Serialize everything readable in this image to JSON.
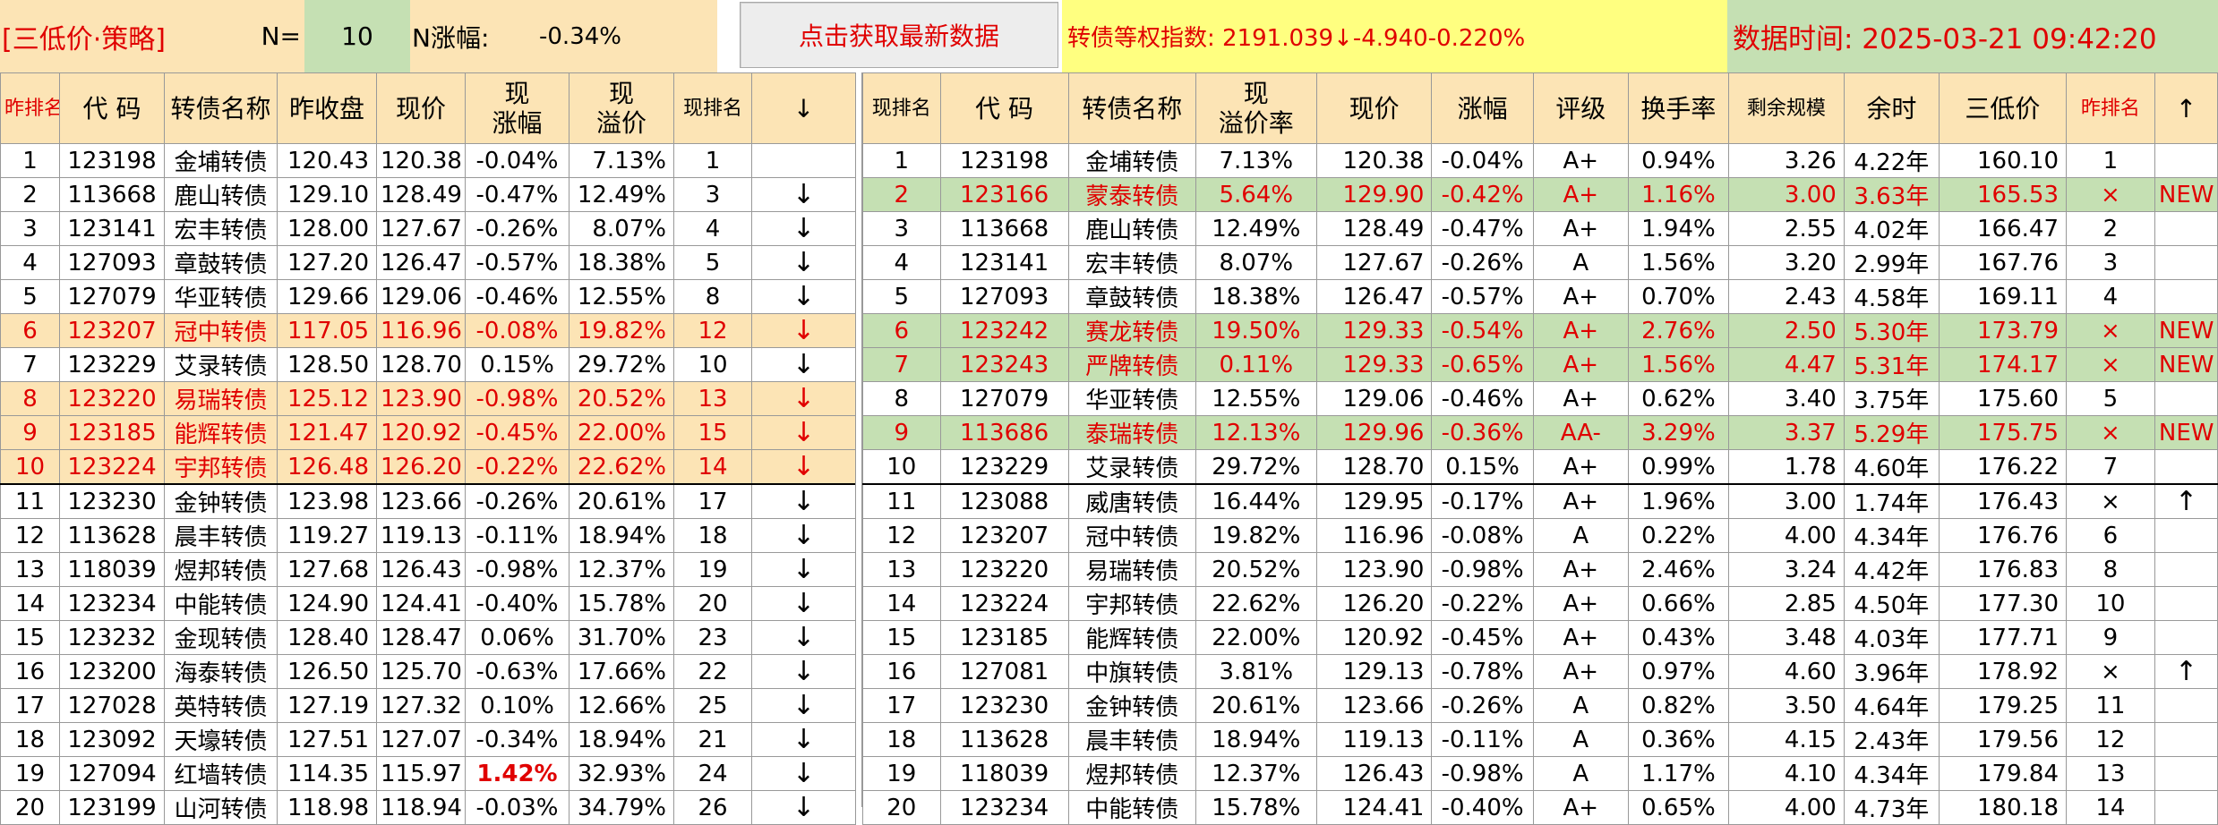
{
  "header": {
    "strategy": "[三低价·策略]",
    "n_label": "N=",
    "n_value": "10",
    "chg_label": "N涨幅:",
    "chg_value": "-0.34%",
    "refresh_button": "点击获取最新数据",
    "index_text": "转债等权指数:  2191.039↓-4.940-0.220%",
    "time_text": "数据时间: 2025-03-21 09:42:20"
  },
  "left": {
    "columns": [
      "昨排名",
      "代 码",
      "转债名称",
      "昨收盘",
      "现价",
      "现\n涨幅",
      "现\n溢价",
      "现排名",
      "↓"
    ],
    "rows": [
      {
        "rank": "1",
        "code": "123198",
        "name": "金埔转债",
        "prev": "120.43",
        "price": "120.38",
        "chg": "-0.04%",
        "prem": "7.13%",
        "now": "1",
        "arrow": ""
      },
      {
        "rank": "2",
        "code": "113668",
        "name": "鹿山转债",
        "prev": "129.10",
        "price": "128.49",
        "chg": "-0.47%",
        "prem": "12.49%",
        "now": "3",
        "arrow": "↓"
      },
      {
        "rank": "3",
        "code": "123141",
        "name": "宏丰转债",
        "prev": "128.00",
        "price": "127.67",
        "chg": "-0.26%",
        "prem": "8.07%",
        "now": "4",
        "arrow": "↓"
      },
      {
        "rank": "4",
        "code": "127093",
        "name": "章鼓转债",
        "prev": "127.20",
        "price": "126.47",
        "chg": "-0.57%",
        "prem": "18.38%",
        "now": "5",
        "arrow": "↓"
      },
      {
        "rank": "5",
        "code": "127079",
        "name": "华亚转债",
        "prev": "129.66",
        "price": "129.06",
        "chg": "-0.46%",
        "prem": "12.55%",
        "now": "8",
        "arrow": "↓"
      },
      {
        "rank": "6",
        "code": "123207",
        "name": "冠中转债",
        "prev": "117.05",
        "price": "116.96",
        "chg": "-0.08%",
        "prem": "19.82%",
        "now": "12",
        "arrow": "↓"
      },
      {
        "rank": "7",
        "code": "123229",
        "name": "艾录转债",
        "prev": "128.50",
        "price": "128.70",
        "chg": "0.15%",
        "prem": "29.72%",
        "now": "10",
        "arrow": "↓"
      },
      {
        "rank": "8",
        "code": "123220",
        "name": "易瑞转债",
        "prev": "125.12",
        "price": "123.90",
        "chg": "-0.98%",
        "prem": "20.52%",
        "now": "13",
        "arrow": "↓"
      },
      {
        "rank": "9",
        "code": "123185",
        "name": "能辉转债",
        "prev": "121.47",
        "price": "120.92",
        "chg": "-0.45%",
        "prem": "22.00%",
        "now": "15",
        "arrow": "↓"
      },
      {
        "rank": "10",
        "code": "123224",
        "name": "宇邦转债",
        "prev": "126.48",
        "price": "126.20",
        "chg": "-0.22%",
        "prem": "22.62%",
        "now": "14",
        "arrow": "↓"
      },
      {
        "rank": "11",
        "code": "123230",
        "name": "金钟转债",
        "prev": "123.98",
        "price": "123.66",
        "chg": "-0.26%",
        "prem": "20.61%",
        "now": "17",
        "arrow": "↓"
      },
      {
        "rank": "12",
        "code": "113628",
        "name": "晨丰转债",
        "prev": "119.27",
        "price": "119.13",
        "chg": "-0.11%",
        "prem": "18.94%",
        "now": "18",
        "arrow": "↓"
      },
      {
        "rank": "13",
        "code": "118039",
        "name": "煜邦转债",
        "prev": "127.68",
        "price": "126.43",
        "chg": "-0.98%",
        "prem": "12.37%",
        "now": "19",
        "arrow": "↓"
      },
      {
        "rank": "14",
        "code": "123234",
        "name": "中能转债",
        "prev": "124.90",
        "price": "124.41",
        "chg": "-0.40%",
        "prem": "15.78%",
        "now": "20",
        "arrow": "↓"
      },
      {
        "rank": "15",
        "code": "123232",
        "name": "金现转债",
        "prev": "128.40",
        "price": "128.47",
        "chg": "0.06%",
        "prem": "31.70%",
        "now": "23",
        "arrow": "↓"
      },
      {
        "rank": "16",
        "code": "123200",
        "name": "海泰转债",
        "prev": "126.50",
        "price": "125.70",
        "chg": "-0.63%",
        "prem": "17.66%",
        "now": "22",
        "arrow": "↓"
      },
      {
        "rank": "17",
        "code": "127028",
        "name": "英特转债",
        "prev": "127.19",
        "price": "127.32",
        "chg": "0.10%",
        "prem": "12.66%",
        "now": "25",
        "arrow": "↓"
      },
      {
        "rank": "18",
        "code": "123092",
        "name": "天壕转债",
        "prev": "127.51",
        "price": "127.07",
        "chg": "-0.34%",
        "prem": "18.94%",
        "now": "21",
        "arrow": "↓"
      },
      {
        "rank": "19",
        "code": "127094",
        "name": "红墙转债",
        "prev": "114.35",
        "price": "115.97",
        "chg": "1.42%",
        "prem": "32.93%",
        "now": "24",
        "arrow": "↓"
      },
      {
        "rank": "20",
        "code": "123199",
        "name": "山河转债",
        "prev": "118.98",
        "price": "118.94",
        "chg": "-0.03%",
        "prem": "34.79%",
        "now": "26",
        "arrow": "↓"
      }
    ]
  },
  "right": {
    "columns": [
      "现排名",
      "代 码",
      "转债名称",
      "现\n溢价率",
      "现价",
      "涨幅",
      "评级",
      "换手率",
      "剩余规模",
      "余时",
      "三低价",
      "昨排名",
      "↑"
    ],
    "rows": [
      {
        "now": "1",
        "code": "123198",
        "name": "金埔转债",
        "prem": "7.13%",
        "price": "120.38",
        "chg": "-0.04%",
        "rating": "A+",
        "turn": "0.94%",
        "size": "3.26",
        "rest": "4.22年",
        "tri": "160.10",
        "yday": "1",
        "flag": ""
      },
      {
        "now": "2",
        "code": "123166",
        "name": "蒙泰转债",
        "prem": "5.64%",
        "price": "129.90",
        "chg": "-0.42%",
        "rating": "A+",
        "turn": "1.16%",
        "size": "3.00",
        "rest": "3.63年",
        "tri": "165.53",
        "yday": "×",
        "flag": "NEW"
      },
      {
        "now": "3",
        "code": "113668",
        "name": "鹿山转债",
        "prem": "12.49%",
        "price": "128.49",
        "chg": "-0.47%",
        "rating": "A+",
        "turn": "1.94%",
        "size": "2.55",
        "rest": "4.02年",
        "tri": "166.47",
        "yday": "2",
        "flag": ""
      },
      {
        "now": "4",
        "code": "123141",
        "name": "宏丰转债",
        "prem": "8.07%",
        "price": "127.67",
        "chg": "-0.26%",
        "rating": "A",
        "turn": "1.56%",
        "size": "3.20",
        "rest": "2.99年",
        "tri": "167.76",
        "yday": "3",
        "flag": ""
      },
      {
        "now": "5",
        "code": "127093",
        "name": "章鼓转债",
        "prem": "18.38%",
        "price": "126.47",
        "chg": "-0.57%",
        "rating": "A+",
        "turn": "0.70%",
        "size": "2.43",
        "rest": "4.58年",
        "tri": "169.11",
        "yday": "4",
        "flag": ""
      },
      {
        "now": "6",
        "code": "123242",
        "name": "赛龙转债",
        "prem": "19.50%",
        "price": "129.33",
        "chg": "-0.54%",
        "rating": "A+",
        "turn": "2.76%",
        "size": "2.50",
        "rest": "5.30年",
        "tri": "173.79",
        "yday": "×",
        "flag": "NEW"
      },
      {
        "now": "7",
        "code": "123243",
        "name": "严牌转债",
        "prem": "0.11%",
        "price": "129.33",
        "chg": "-0.65%",
        "rating": "A+",
        "turn": "1.56%",
        "size": "4.47",
        "rest": "5.31年",
        "tri": "174.17",
        "yday": "×",
        "flag": "NEW"
      },
      {
        "now": "8",
        "code": "127079",
        "name": "华亚转债",
        "prem": "12.55%",
        "price": "129.06",
        "chg": "-0.46%",
        "rating": "A+",
        "turn": "0.62%",
        "size": "3.40",
        "rest": "3.75年",
        "tri": "175.60",
        "yday": "5",
        "flag": ""
      },
      {
        "now": "9",
        "code": "113686",
        "name": "泰瑞转债",
        "prem": "12.13%",
        "price": "129.96",
        "chg": "-0.36%",
        "rating": "AA-",
        "turn": "3.29%",
        "size": "3.37",
        "rest": "5.29年",
        "tri": "175.75",
        "yday": "×",
        "flag": "NEW"
      },
      {
        "now": "10",
        "code": "123229",
        "name": "艾录转债",
        "prem": "29.72%",
        "price": "128.70",
        "chg": "0.15%",
        "rating": "A+",
        "turn": "0.99%",
        "size": "1.78",
        "rest": "4.60年",
        "tri": "176.22",
        "yday": "7",
        "flag": ""
      },
      {
        "now": "11",
        "code": "123088",
        "name": "威唐转债",
        "prem": "16.44%",
        "price": "129.95",
        "chg": "-0.17%",
        "rating": "A+",
        "turn": "1.96%",
        "size": "3.00",
        "rest": "1.74年",
        "tri": "176.43",
        "yday": "×",
        "flag": "↑"
      },
      {
        "now": "12",
        "code": "123207",
        "name": "冠中转债",
        "prem": "19.82%",
        "price": "116.96",
        "chg": "-0.08%",
        "rating": "A",
        "turn": "0.22%",
        "size": "4.00",
        "rest": "4.34年",
        "tri": "176.76",
        "yday": "6",
        "flag": ""
      },
      {
        "now": "13",
        "code": "123220",
        "name": "易瑞转债",
        "prem": "20.52%",
        "price": "123.90",
        "chg": "-0.98%",
        "rating": "A+",
        "turn": "2.46%",
        "size": "3.24",
        "rest": "4.42年",
        "tri": "176.83",
        "yday": "8",
        "flag": ""
      },
      {
        "now": "14",
        "code": "123224",
        "name": "宇邦转债",
        "prem": "22.62%",
        "price": "126.20",
        "chg": "-0.22%",
        "rating": "A+",
        "turn": "0.66%",
        "size": "2.85",
        "rest": "4.50年",
        "tri": "177.30",
        "yday": "10",
        "flag": ""
      },
      {
        "now": "15",
        "code": "123185",
        "name": "能辉转债",
        "prem": "22.00%",
        "price": "120.92",
        "chg": "-0.45%",
        "rating": "A+",
        "turn": "0.43%",
        "size": "3.48",
        "rest": "4.03年",
        "tri": "177.71",
        "yday": "9",
        "flag": ""
      },
      {
        "now": "16",
        "code": "127081",
        "name": "中旗转债",
        "prem": "3.81%",
        "price": "129.13",
        "chg": "-0.78%",
        "rating": "A+",
        "turn": "0.97%",
        "size": "4.60",
        "rest": "3.96年",
        "tri": "178.92",
        "yday": "×",
        "flag": "↑"
      },
      {
        "now": "17",
        "code": "123230",
        "name": "金钟转债",
        "prem": "20.61%",
        "price": "123.66",
        "chg": "-0.26%",
        "rating": "A",
        "turn": "0.82%",
        "size": "3.50",
        "rest": "4.64年",
        "tri": "179.25",
        "yday": "11",
        "flag": ""
      },
      {
        "now": "18",
        "code": "113628",
        "name": "晨丰转债",
        "prem": "18.94%",
        "price": "119.13",
        "chg": "-0.11%",
        "rating": "A",
        "turn": "0.36%",
        "size": "4.15",
        "rest": "2.43年",
        "tri": "179.56",
        "yday": "12",
        "flag": ""
      },
      {
        "now": "19",
        "code": "118039",
        "name": "煜邦转债",
        "prem": "12.37%",
        "price": "126.43",
        "chg": "-0.98%",
        "rating": "A",
        "turn": "1.17%",
        "size": "4.10",
        "rest": "4.34年",
        "tri": "179.84",
        "yday": "13",
        "flag": ""
      },
      {
        "now": "20",
        "code": "123234",
        "name": "中能转债",
        "prem": "15.78%",
        "price": "124.41",
        "chg": "-0.40%",
        "rating": "A+",
        "turn": "0.65%",
        "size": "4.00",
        "rest": "4.73年",
        "tri": "180.18",
        "yday": "14",
        "flag": ""
      }
    ]
  },
  "colors": {
    "accent_red": "#E00000",
    "orange_fill": "#FCE4B5",
    "green_fill": "#C5E0B3",
    "yellow_fill": "#FFFF80"
  }
}
